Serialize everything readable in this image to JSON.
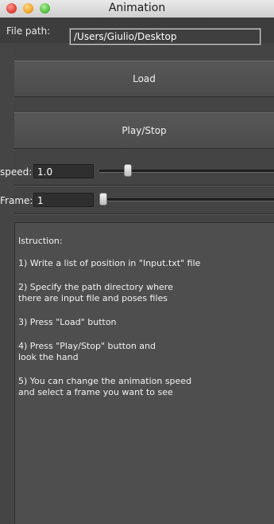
{
  "window": {
    "title": "Animation"
  },
  "file_path": {
    "label": "File path:",
    "value": "/Users/Giulio/Desktop"
  },
  "buttons": {
    "load": "Load",
    "play_stop": "Play/Stop"
  },
  "speed": {
    "label": "speed:",
    "value": "1.0",
    "slider_level": 0.14
  },
  "frame": {
    "label": "Frame:",
    "value": "1",
    "slider_level": 0.0
  },
  "instructions": {
    "heading": "Istruction:",
    "step1": "1) Write a list of position in \"Input.txt\" file",
    "step2a": "2) Specify the path directory where",
    "step2b": "there are input file and poses files",
    "step3": "3) Press \"Load\" button",
    "step4a": "4) Press \"Play/Stop\" button and",
    "step4b": "look the hand",
    "step5a": "5) You can change the animation speed",
    "step5b": "and select a frame you want to see"
  },
  "colors": {
    "window_bg": "#444444",
    "button_bg": "#555555",
    "panel_bg": "#4e4e4e",
    "text": "#f0f0f0"
  }
}
